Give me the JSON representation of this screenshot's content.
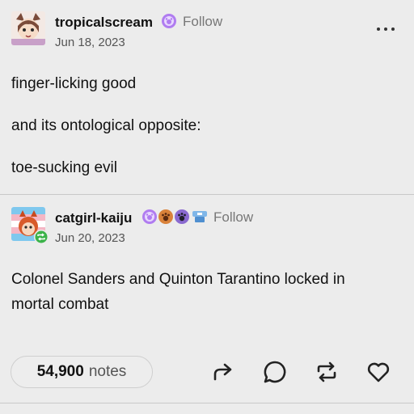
{
  "post": {
    "author": "tropicalscream",
    "follow": "Follow",
    "date": "Jun 18, 2023",
    "paragraphs": [
      "finger-licking good",
      "and its ontological opposite:",
      "toe-sucking evil"
    ]
  },
  "reblog": {
    "author": "catgirl-kaiju",
    "follow": "Follow",
    "date": "Jun 20, 2023",
    "text_line1": "Colonel Sanders and Quinton Tarantino locked in",
    "text_line2": "mortal combat"
  },
  "footer": {
    "notes_count": "54,900",
    "notes_word": "notes"
  },
  "icons": {
    "more": "more-options-icon",
    "share": "share-icon",
    "reply": "reply-icon",
    "reblog": "reblog-icon",
    "like": "heart-icon"
  },
  "colors": {
    "background": "#ececec",
    "badge_purple": "#b07cf0",
    "badge_orange": "#d9823a",
    "reblog_green": "#3cb34a"
  }
}
